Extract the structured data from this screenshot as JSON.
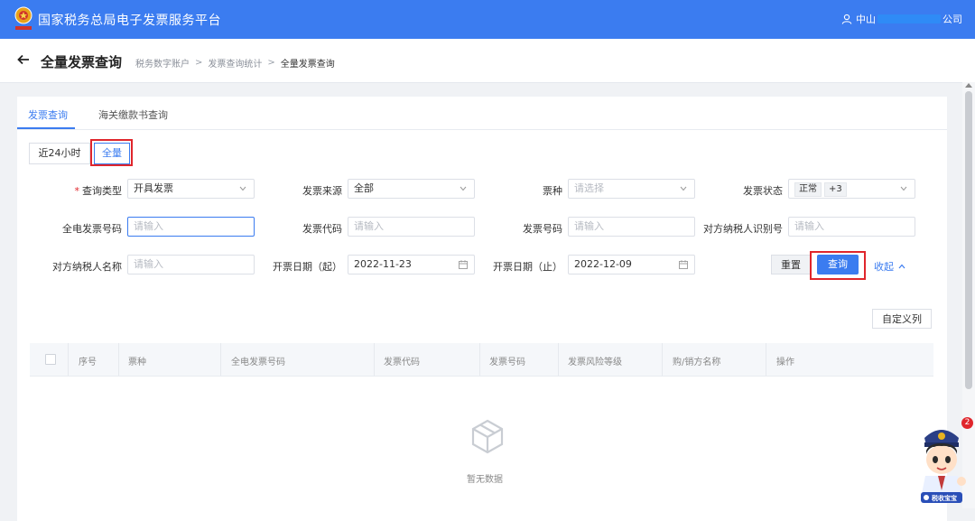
{
  "header": {
    "app_title": "国家税务总局电子发票服务平台",
    "user_prefix": "中山",
    "user_suffix": "公司"
  },
  "subheader": {
    "page_title": "全量发票查询",
    "breadcrumb": [
      "税务数字账户",
      "发票查询统计",
      "全量发票查询"
    ]
  },
  "tabs": [
    {
      "label": "发票查询",
      "active": true
    },
    {
      "label": "海关缴款书查询",
      "active": false
    }
  ],
  "range_buttons": [
    {
      "label": "近24小时",
      "active": false
    },
    {
      "label": "全量",
      "active": true
    }
  ],
  "form": {
    "query_type": {
      "label": "查询类型",
      "required": true,
      "value": "开具发票"
    },
    "source": {
      "label": "发票来源",
      "value": "全部"
    },
    "ticket_type": {
      "label": "票种",
      "placeholder": "请选择"
    },
    "status": {
      "label": "发票状态",
      "tags": [
        "正常",
        "+3"
      ]
    },
    "all_elec_no": {
      "label": "全电发票号码",
      "placeholder": "请输入"
    },
    "invoice_code": {
      "label": "发票代码",
      "placeholder": "请输入"
    },
    "invoice_no": {
      "label": "发票号码",
      "placeholder": "请输入"
    },
    "counterparty_id": {
      "label": "对方纳税人识别号",
      "placeholder": "请输入"
    },
    "counterparty_name": {
      "label": "对方纳税人名称",
      "placeholder": "请输入"
    },
    "date_start": {
      "label": "开票日期（起）",
      "value": "2022-11-23"
    },
    "date_end": {
      "label": "开票日期（止）",
      "value": "2022-12-09"
    }
  },
  "actions": {
    "reset": "重置",
    "query": "查询",
    "collapse": "收起",
    "custom_columns": "自定义列"
  },
  "table": {
    "columns": [
      "序号",
      "票种",
      "全电发票号码",
      "发票代码",
      "发票号码",
      "发票风险等级",
      "购/销方名称",
      "操作"
    ],
    "empty_text": "暂无数据"
  },
  "assistant": {
    "badge_count": "2",
    "label": "税收宝宝"
  },
  "colors": {
    "primary": "#3b7cf0",
    "highlight_box": "#e0262c"
  }
}
